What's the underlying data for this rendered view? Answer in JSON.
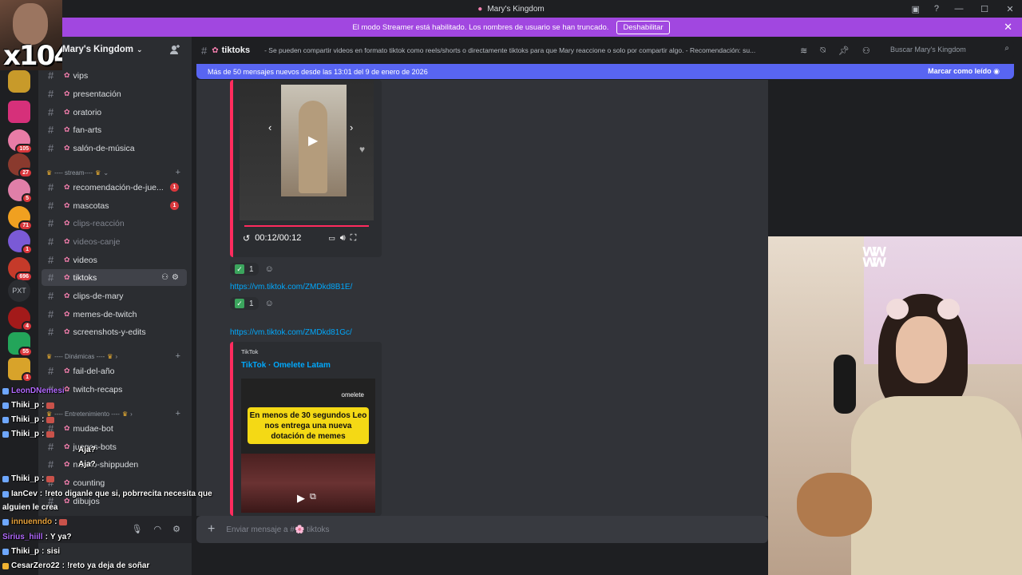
{
  "window": {
    "title": "Mary's Kingdom",
    "title_icon": "pig-icon"
  },
  "banner": {
    "text": "El modo Streamer está habilitado. Los nombres de usuario se han truncado.",
    "button": "Deshabilitar"
  },
  "overlay_multiplier": "x104",
  "servers": [
    {
      "badge": ""
    },
    {
      "badge": ""
    },
    {
      "badge": "105"
    },
    {
      "badge": "27"
    },
    {
      "badge": "5"
    },
    {
      "badge": "71"
    },
    {
      "badge": "1"
    },
    {
      "badge": "696"
    },
    {
      "badge": ""
    },
    {
      "badge": "4"
    },
    {
      "badge": "55"
    },
    {
      "badge": "1"
    }
  ],
  "server_text_icon": "PXT",
  "server": {
    "name": "Mary's Kingdom"
  },
  "channels_top": [
    {
      "name": "vips",
      "muted": false
    },
    {
      "name": "presentación",
      "muted": false
    },
    {
      "name": "oratorio",
      "muted": false
    },
    {
      "name": "fan-arts",
      "muted": false
    },
    {
      "name": "salón-de-música",
      "muted": false
    }
  ],
  "categories": {
    "stream": "---- stream----",
    "dinamicas": "---- Dinámicas ----",
    "entretenimiento": "---- Entretenimiento ----"
  },
  "channels_stream": [
    {
      "name": "recomendación-de-jue...",
      "unread": "1",
      "muted": false
    },
    {
      "name": "mascotas",
      "unread": "1",
      "muted": false
    },
    {
      "name": "clips-reacción",
      "unread": "",
      "muted": true
    },
    {
      "name": "videos-canje",
      "unread": "",
      "muted": true
    },
    {
      "name": "videos",
      "unread": "",
      "muted": false
    },
    {
      "name": "tiktoks",
      "unread": "",
      "muted": false
    },
    {
      "name": "clips-de-mary",
      "unread": "",
      "muted": false
    },
    {
      "name": "memes-de-twitch",
      "unread": "",
      "muted": false
    },
    {
      "name": "screenshots-y-edits",
      "unread": "",
      "muted": false
    }
  ],
  "channels_dinamicas": [
    {
      "name": "fail-del-año"
    },
    {
      "name": "twitch-recaps"
    }
  ],
  "channels_entretenimiento": [
    {
      "name": "mudae-bot"
    },
    {
      "name": "juegos-bots"
    },
    {
      "name": "naruto-shippuden"
    },
    {
      "name": "counting"
    },
    {
      "name": "dibujos"
    }
  ],
  "main": {
    "channel": "tiktoks",
    "topic": "- Se pueden compartir videos en formato tiktok como reels/shorts o directamente tiktoks para que Mary reaccione o solo por compartir algo. - Recomendación: su...",
    "search_placeholder": "Buscar Mary's Kingdom",
    "new_messages": "Más de 50 mensajes nuevos desde las 13:01 del 9 de enero de 2026",
    "mark_read": "Marcar como leído",
    "video_time": "00:12/00:12",
    "reaction_count_1": "1",
    "link_1": "https://vm.tiktok.com/ZMDkd8B1E/",
    "reaction_count_2": "1",
    "link_2": "https://vm.tiktok.com/ZMDkd81Gc/",
    "embed_provider": "TikTok",
    "embed_title": "TikTok · Omelete Latam",
    "embed_image_text": "En menos de 30 segundos Leo nos entrega una nueva dotación de memes",
    "embed_brand": "omelete",
    "composer_placeholder": "Enviar mensaje a #🌸 tiktoks"
  },
  "chat": [
    {
      "user": "LeonDNemesi",
      "msg": "",
      "color": "#b36bff"
    },
    {
      "user": "Thiki_p",
      "msg": "",
      "color": "#ffffff"
    },
    {
      "user": "Thiki_p",
      "msg": "",
      "color": "#ffffff"
    },
    {
      "user": "Thiki_p",
      "msg": "",
      "color": "#ffffff"
    },
    {
      "user": "",
      "msg": "Aja?",
      "color": "#ffffff"
    },
    {
      "user": "",
      "msg": "Aja?",
      "color": "#ffffff"
    },
    {
      "user": "Thiki_p",
      "msg": "",
      "color": "#ffffff"
    },
    {
      "user": "IanCev",
      "msg": "!reto diganle que si, pobrrecita necesita que",
      "color": "#ffffff"
    },
    {
      "user": "",
      "msg": "alguien le crea",
      "color": "#ffffff"
    },
    {
      "user": "innuenndo",
      "msg": "",
      "color": "#e8a33d"
    },
    {
      "user": "Sirius_hiill",
      "msg": "Y ya?",
      "color": "#b36bff"
    },
    {
      "user": "Thiki_p",
      "msg": "sisi",
      "color": "#ffffff"
    },
    {
      "user": "CesarZero22",
      "msg": "!reto ya deja de soñar",
      "color": "#ffffff"
    }
  ]
}
